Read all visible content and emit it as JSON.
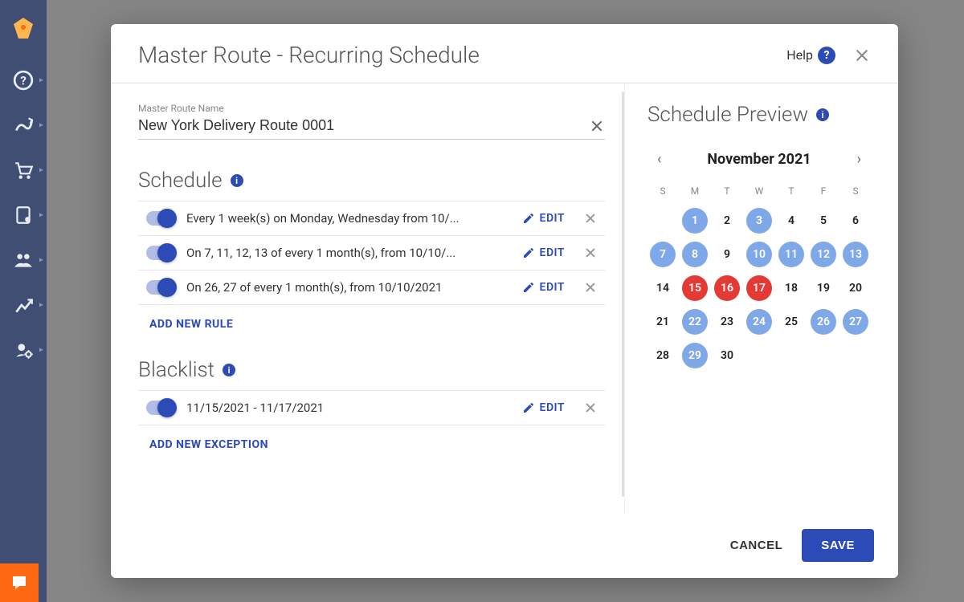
{
  "sidebar": {
    "icons": [
      "help-icon",
      "routes-icon",
      "orders-icon",
      "addressbook-icon",
      "team-icon",
      "analytics-icon",
      "settings-icon"
    ]
  },
  "modal": {
    "title": "Master Route - Recurring Schedule",
    "help_label": "Help",
    "name_field": {
      "label": "Master Route Name",
      "value": "New York Delivery Route 0001"
    },
    "schedule": {
      "title": "Schedule",
      "rules": [
        {
          "text": "Every 1 week(s) on Monday, Wednesday from 10/...",
          "edit": "EDIT"
        },
        {
          "text": "On 7, 11, 12, 13 of every 1 month(s), from 10/10/...",
          "edit": "EDIT"
        },
        {
          "text": "On 26, 27 of every 1 month(s), from 10/10/2021",
          "edit": "EDIT"
        }
      ],
      "add_label": "ADD NEW RULE"
    },
    "blacklist": {
      "title": "Blacklist",
      "rules": [
        {
          "text": "11/15/2021 - 11/17/2021",
          "edit": "EDIT"
        }
      ],
      "add_label": "ADD NEW EXCEPTION"
    },
    "preview": {
      "title": "Schedule Preview",
      "month_label": "November 2021",
      "dow": [
        "S",
        "M",
        "T",
        "W",
        "T",
        "F",
        "S"
      ],
      "offset": 1,
      "days": [
        {
          "d": 1,
          "s": "selected"
        },
        {
          "d": 2,
          "s": ""
        },
        {
          "d": 3,
          "s": "selected"
        },
        {
          "d": 4,
          "s": ""
        },
        {
          "d": 5,
          "s": ""
        },
        {
          "d": 6,
          "s": ""
        },
        {
          "d": 7,
          "s": "selected"
        },
        {
          "d": 8,
          "s": "selected"
        },
        {
          "d": 9,
          "s": ""
        },
        {
          "d": 10,
          "s": "selected"
        },
        {
          "d": 11,
          "s": "selected"
        },
        {
          "d": 12,
          "s": "selected"
        },
        {
          "d": 13,
          "s": "selected"
        },
        {
          "d": 14,
          "s": ""
        },
        {
          "d": 15,
          "s": "blacklist"
        },
        {
          "d": 16,
          "s": "blacklist"
        },
        {
          "d": 17,
          "s": "blacklist"
        },
        {
          "d": 18,
          "s": ""
        },
        {
          "d": 19,
          "s": ""
        },
        {
          "d": 20,
          "s": ""
        },
        {
          "d": 21,
          "s": ""
        },
        {
          "d": 22,
          "s": "selected"
        },
        {
          "d": 23,
          "s": ""
        },
        {
          "d": 24,
          "s": "selected"
        },
        {
          "d": 25,
          "s": ""
        },
        {
          "d": 26,
          "s": "selected"
        },
        {
          "d": 27,
          "s": "selected"
        },
        {
          "d": 28,
          "s": ""
        },
        {
          "d": 29,
          "s": "selected"
        },
        {
          "d": 30,
          "s": ""
        }
      ]
    },
    "footer": {
      "cancel": "CANCEL",
      "save": "SAVE"
    }
  }
}
